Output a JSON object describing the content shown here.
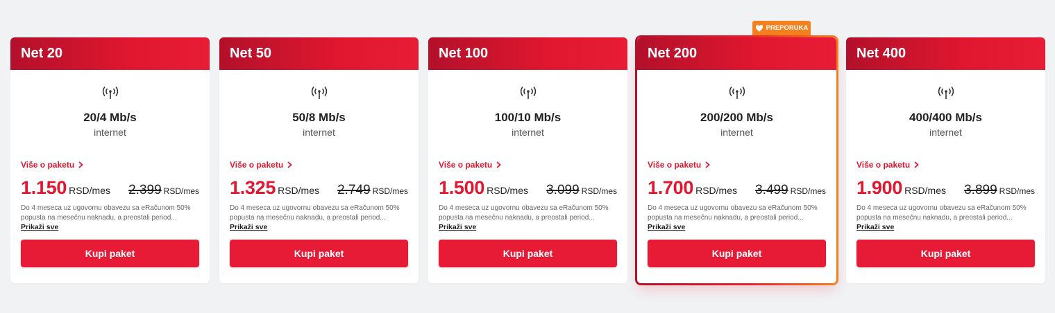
{
  "colors": {
    "accent": "#e0172f",
    "badge": "#f4801f",
    "header_gradient_start": "#b3102b",
    "header_gradient_end": "#e81d35"
  },
  "badge": {
    "label": "PREPORUKA",
    "icon": "heart-icon"
  },
  "cards": [
    {
      "title": "Net 20",
      "speed": "20/4 Mb/s",
      "speed_label": "internet",
      "more_label": "Više o paketu",
      "price_new": "1.150",
      "price_new_unit": "RSD/mes",
      "price_old": "2.399",
      "price_old_unit": "RSD/mes",
      "promo": "Do 4 meseca uz ugovornu obavezu sa eRačunom 50% popusta na mesečnu naknadu, a preostali period...",
      "show_all": "Prikaži sve",
      "buy_label": "Kupi paket",
      "featured": false
    },
    {
      "title": "Net 50",
      "speed": "50/8 Mb/s",
      "speed_label": "internet",
      "more_label": "Više o paketu",
      "price_new": "1.325",
      "price_new_unit": "RSD/mes",
      "price_old": "2.749",
      "price_old_unit": "RSD/mes",
      "promo": "Do 4 meseca uz ugovornu obavezu sa eRačunom 50% popusta na mesečnu naknadu, a preostali period...",
      "show_all": "Prikaži sve",
      "buy_label": "Kupi paket",
      "featured": false
    },
    {
      "title": "Net 100",
      "speed": "100/10 Mb/s",
      "speed_label": "internet",
      "more_label": "Više o paketu",
      "price_new": "1.500",
      "price_new_unit": "RSD/mes",
      "price_old": "3.099",
      "price_old_unit": "RSD/mes",
      "promo": "Do 4 meseca uz ugovornu obavezu sa eRačunom 50% popusta na mesečnu naknadu, a preostali period...",
      "show_all": "Prikaži sve",
      "buy_label": "Kupi paket",
      "featured": false
    },
    {
      "title": "Net 200",
      "speed": "200/200 Mb/s",
      "speed_label": "internet",
      "more_label": "Više o paketu",
      "price_new": "1.700",
      "price_new_unit": "RSD/mes",
      "price_old": "3.499",
      "price_old_unit": "RSD/mes",
      "promo": "Do 4 meseca uz ugovornu obavezu sa eRačunom 50% popusta na mesečnu naknadu, a preostali period...",
      "show_all": "Prikaži sve",
      "buy_label": "Kupi paket",
      "featured": true
    },
    {
      "title": "Net 400",
      "speed": "400/400 Mb/s",
      "speed_label": "internet",
      "more_label": "Više o paketu",
      "price_new": "1.900",
      "price_new_unit": "RSD/mes",
      "price_old": "3.899",
      "price_old_unit": "RSD/mes",
      "promo": "Do 4 meseca uz ugovornu obavezu sa eRačunom 50% popusta na mesečnu naknadu, a preostali period...",
      "show_all": "Prikaži sve",
      "buy_label": "Kupi paket",
      "featured": false
    }
  ]
}
